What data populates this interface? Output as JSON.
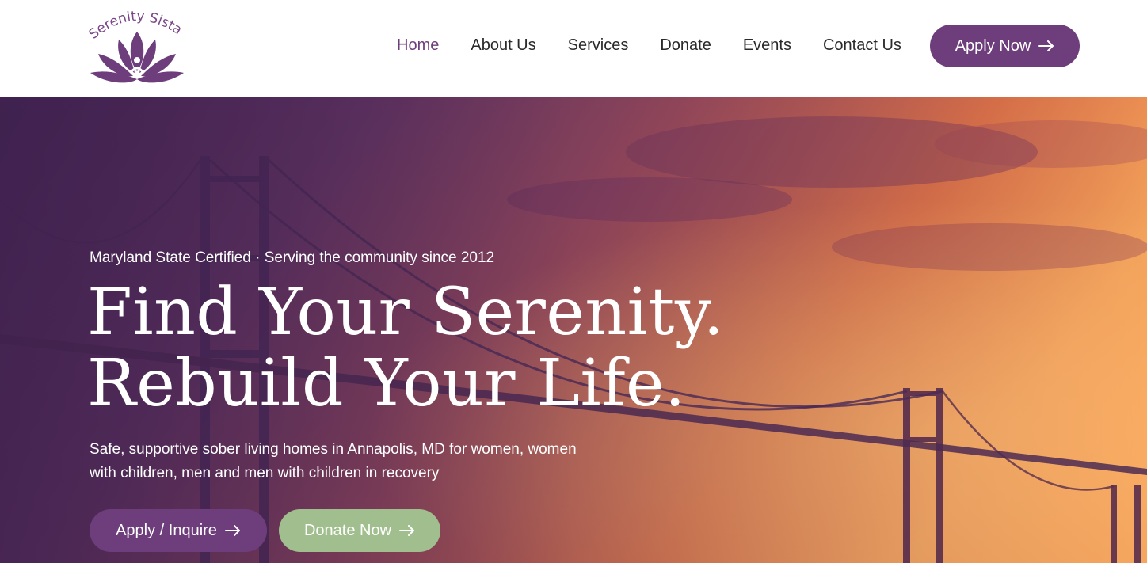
{
  "brand": {
    "logo_text": "Serenity Sistas",
    "accent": "#6e3d7c",
    "secondary": "#a1bf8e"
  },
  "nav": {
    "items": [
      {
        "label": "Home",
        "active": true
      },
      {
        "label": "About Us",
        "active": false
      },
      {
        "label": "Services",
        "active": false
      },
      {
        "label": "Donate",
        "active": false
      },
      {
        "label": "Events",
        "active": false
      },
      {
        "label": "Contact Us",
        "active": false
      }
    ],
    "cta_label": "Apply Now",
    "cta_icon": "arrow-right-icon"
  },
  "hero": {
    "eyebrow": "Maryland State Certified · Serving the community since 2012",
    "headline_line1": "Find Your Serenity.",
    "headline_line2": "Rebuild Your Life.",
    "subtext": "Safe, supportive sober living homes in Annapolis, MD for women, women with children, men and men with children in recovery",
    "primary_cta": "Apply / Inquire",
    "secondary_cta": "Donate Now",
    "background": "bridge-sunset-photo"
  }
}
